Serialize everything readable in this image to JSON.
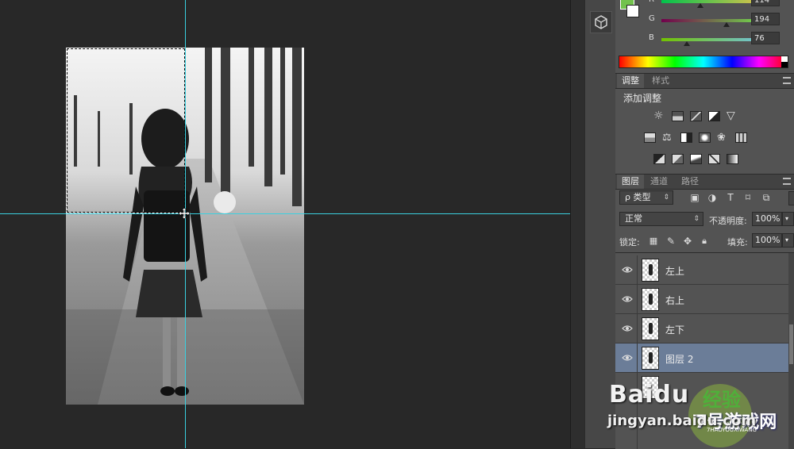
{
  "color_panel": {
    "channels": [
      {
        "label": "R",
        "value": "114",
        "level": 0.45,
        "gradient": "linear-gradient(to right,#00c24c,#ffc24c)"
      },
      {
        "label": "G",
        "value": "194",
        "level": 0.76,
        "gradient": "linear-gradient(to right,#72004c,#72ff4c)"
      },
      {
        "label": "B",
        "value": "76",
        "level": 0.3,
        "gradient": "linear-gradient(to right,#72c200,#72c2ff)"
      }
    ],
    "foreground_color": "#72c24c",
    "background_color": "#ffffff"
  },
  "adjustments_panel": {
    "tabs": [
      "调整",
      "样式"
    ],
    "title": "添加调整"
  },
  "layers_panel": {
    "tabs": [
      "图层",
      "通道",
      "路径"
    ],
    "filter_kind": "ρ 类型",
    "blend_mode": "正常",
    "opacity_label": "不透明度:",
    "opacity_value": "100%",
    "lock_label": "锁定:",
    "fill_label": "填充:",
    "fill_value": "100%",
    "layers": [
      {
        "name": "左上",
        "visible": true,
        "selected": false
      },
      {
        "name": "右上",
        "visible": true,
        "selected": false
      },
      {
        "name": "左下",
        "visible": true,
        "selected": false
      },
      {
        "name": "图层 2",
        "visible": true,
        "selected": true
      }
    ]
  },
  "watermark": {
    "baidu": "Baidu",
    "jingyan_cn": "经验",
    "url": "jingyan.baidu.com",
    "seal_text": "7号游戏网",
    "seal_domain": "7HAOYOUXIWANG"
  },
  "colors": {
    "guide": "#3ad0e0",
    "selected_layer": "#6b7d98",
    "panel_bg": "#535353"
  }
}
